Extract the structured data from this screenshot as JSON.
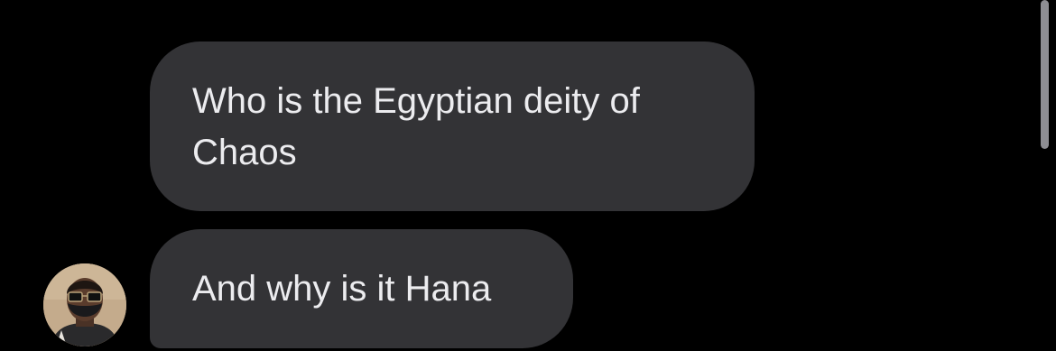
{
  "messages": [
    {
      "text": "Who is the Egyptian deity of Chaos"
    },
    {
      "text": "And why is it Hana"
    }
  ],
  "colors": {
    "background": "#000000",
    "bubble": "#333336",
    "text": "#ececef",
    "scrollbar": "#8e8e93"
  },
  "avatar": {
    "icon": "user-avatar-icon"
  }
}
